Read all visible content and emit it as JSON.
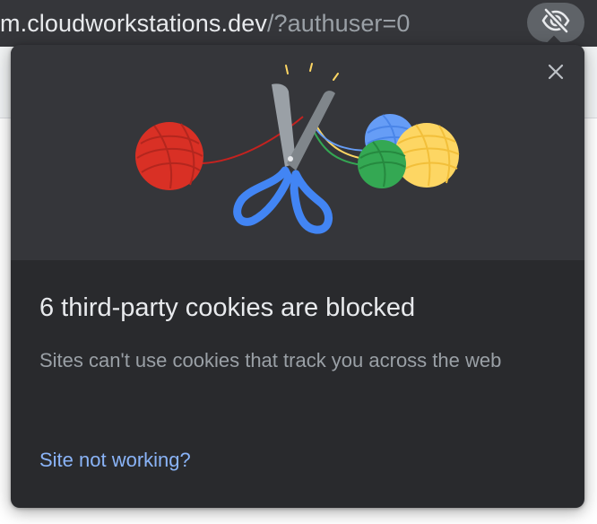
{
  "address_bar": {
    "url_host": "m.cloudworkstations.dev",
    "url_path": "/?authuser=0",
    "tracking_protection_icon": "eye-off-icon"
  },
  "bubble": {
    "close_icon": "close-icon",
    "title": "6 third-party cookies are blocked",
    "description": "Sites can't use cookies that track you across the web",
    "link": "Site not working?"
  },
  "colors": {
    "bubble_bg": "#292a2d",
    "illustration_bg": "#35363a",
    "title_text": "#e8eaed",
    "secondary_text": "#9aa0a6",
    "link": "#8ab4f8",
    "yarn_red": "#d93025",
    "yarn_blue": "#669df6",
    "yarn_green": "#34a853",
    "yarn_yellow": "#fdd663",
    "scissors_handle": "#4285f4"
  }
}
